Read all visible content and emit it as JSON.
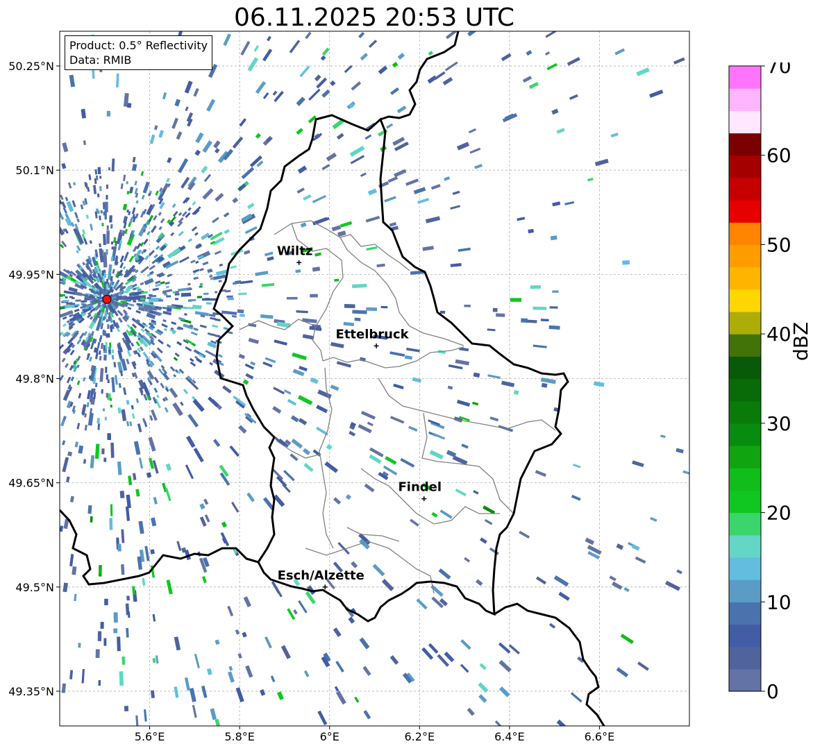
{
  "title": "06.11.2025 20:53 UTC",
  "info": {
    "product": "Product: 0.5° Reflectivity",
    "source": "Data: RMIB"
  },
  "map": {
    "lon_range": [
      5.4,
      6.8
    ],
    "lat_range": [
      49.3,
      50.3
    ],
    "lon_ticks": [
      5.6,
      5.8,
      6.0,
      6.2,
      6.4,
      6.6
    ],
    "lat_ticks": [
      49.35,
      49.5,
      49.65,
      49.8,
      49.95,
      50.1,
      50.25
    ],
    "lon_tick_labels": [
      "5.6°E",
      "5.8°E",
      "6°E",
      "6.2°E",
      "6.4°E",
      "6.6°E"
    ],
    "lat_tick_labels": [
      "49.35°N",
      "49.5°N",
      "49.65°N",
      "49.8°N",
      "49.95°N",
      "50.1°N",
      "50.25°N"
    ],
    "grid": true,
    "radar_site": {
      "lon": 5.505,
      "lat": 49.914,
      "color": "#e8140e"
    },
    "cities": [
      {
        "name": "Wiltz",
        "lon": 5.932,
        "lat": 49.967
      },
      {
        "name": "Ettelbruck",
        "lon": 6.104,
        "lat": 49.847
      },
      {
        "name": "Findel",
        "lon": 6.21,
        "lat": 49.627
      },
      {
        "name": "Esch/Alzette",
        "lon": 5.99,
        "lat": 49.5
      }
    ]
  },
  "colorbar": {
    "label": "dBZ",
    "min": 0,
    "max": 70,
    "step": 2.5,
    "tick_values": [
      0,
      10,
      20,
      30,
      40,
      50,
      60,
      70
    ],
    "tick_labels": [
      "0",
      "10",
      "20",
      "30",
      "40",
      "50",
      "60",
      "70"
    ],
    "colors": [
      "#6373a5",
      "#51639c",
      "#425ca5",
      "#4a73ad",
      "#5a9cc6",
      "#63bdde",
      "#63d6c6",
      "#3ad66b",
      "#10c721",
      "#10bd19",
      "#10a510",
      "#088c10",
      "#087b08",
      "#086b08",
      "#085a08",
      "#427308",
      "#adad08",
      "#ffd600",
      "#ffb500",
      "#ff9c00",
      "#ff8400",
      "#e70000",
      "#c60000",
      "#a50000",
      "#7b0000",
      "#ffe7ff",
      "#ffb5ff",
      "#ff73ff",
      "#ef3aef"
    ]
  }
}
